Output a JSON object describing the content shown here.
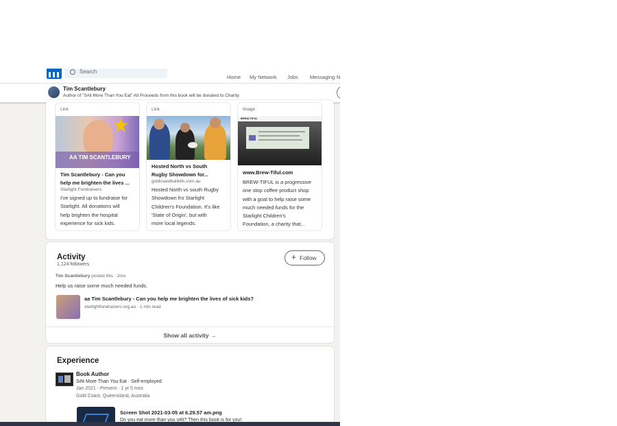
{
  "nav": {
    "search_placeholder": "Search",
    "items": [
      "Home",
      "My Network",
      "Jobs",
      "Messaging",
      "N"
    ]
  },
  "sticky": {
    "name": "Tim Scantlebury",
    "headline": "Author of \"S#it More Than You Eat\" All Proceeds from this book will be donated to Charity."
  },
  "featured": [
    {
      "type": "Link",
      "image_caption": "AA TIM SCANTLEBURY",
      "title": [
        "Tim Scantlebury - Can you",
        "help me brighten the lives ..."
      ],
      "source": "Starlight Fundraisers",
      "description": [
        "I've signed up to fundraise for",
        "Starlight. All donations will",
        "help brighten the hospital",
        "experience for sick kids."
      ]
    },
    {
      "type": "Link",
      "title": [
        "Hosted North vs South",
        "Rugby Showdown for..."
      ],
      "source": "goldcoastbulletin.com.au",
      "description": [
        "Hosted North vs south Rugby",
        "Showdown fro Starlight",
        "Children's Foundation. It's like",
        "'State of Origin', but with",
        "more local legends."
      ]
    },
    {
      "type": "Image",
      "image_caption": "BREW-TIFUL",
      "title": [
        "www.Brew-Tiful.com"
      ],
      "description": [
        "BREW-TIFUL is a progressive",
        "one stop coffee product shop",
        "with a goal to help raise some",
        "much needed funds for the",
        "Starlight Children's",
        "Foundation, a charity that..."
      ]
    }
  ],
  "activity": {
    "heading": "Activity",
    "followers": "1,124 followers",
    "follow_label": "Follow",
    "poster": "Tim Scantlebury",
    "posted_meta": "posted this · 2mo",
    "post_text": "Help us raise some much needed funds.",
    "article_title": "aa Tim Scantlebury - Can you help me brighten the lives of sick kids?",
    "article_meta": "starlightfundraisers.org.au · 1 min read",
    "show_all": "Show all activity"
  },
  "experience": {
    "heading": "Experience",
    "role": "Book Author",
    "company": "S#it More Than You Eat · Self-employed",
    "dates": "Jan 2021 - Present · 1 yr 5 mos",
    "location": "Gold Coast, Queensland, Australia",
    "media_title": "Screen Shot 2021-03-05 at 6.29.57 am.png",
    "media_desc": "Do you eat more than you s#it? Then this book is for you!"
  },
  "colors": {
    "brand": "#0a66c2",
    "page_bg": "#f3f2ef",
    "bottom_bar": "#2f3449"
  }
}
